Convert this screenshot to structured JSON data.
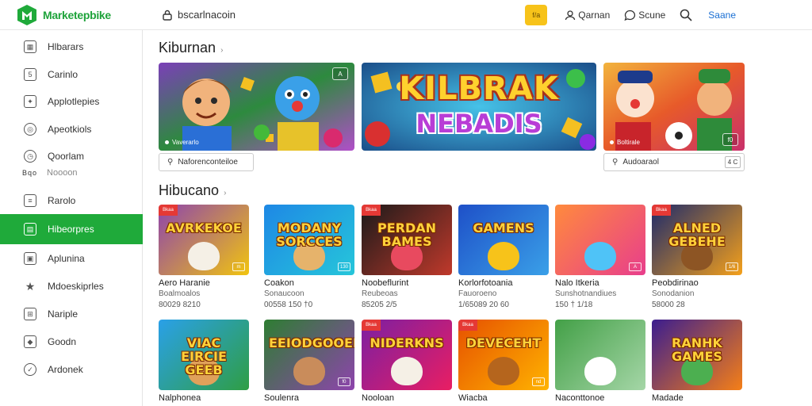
{
  "app": {
    "name": "Marketepbike",
    "search_text": "bscarlnacoin",
    "yellow_button": "f/a",
    "top_link_1": "Qarnan",
    "top_link_2": "Scune",
    "save_label": "Saane",
    "colors": {
      "brand": "#1faa3a",
      "accent_yellow": "#f7c31a",
      "link_blue": "#1a6fd3"
    }
  },
  "sidebar": {
    "items": [
      {
        "label": "Hlbarars",
        "icon": "store-icon"
      },
      {
        "label": "Carinlo",
        "icon": "calendar-icon"
      },
      {
        "label": "Applotlepies",
        "icon": "puzzle-icon"
      },
      {
        "label": "Apeotkiols",
        "icon": "circle-icon"
      },
      {
        "label": "Qoorlam",
        "icon": "clock-icon"
      },
      {
        "label": "Rarolo",
        "icon": "document-icon"
      },
      {
        "label": "Hibeorpres",
        "icon": "folder-icon",
        "active": true
      },
      {
        "label": "Aplunina",
        "icon": "image-icon"
      },
      {
        "label": "Mdoeskiprles",
        "icon": "chart-icon"
      },
      {
        "label": "Nariple",
        "icon": "grid-icon"
      },
      {
        "label": "Goodn",
        "icon": "tag-icon"
      },
      {
        "label": "Ardonek",
        "icon": "check-icon"
      }
    ],
    "sub": {
      "icon_text": "Bqo",
      "label": "Noooon"
    }
  },
  "section1": {
    "title": "Kiburnan",
    "banners": [
      {
        "caption": "Vaverarlo",
        "corner": "A",
        "input": "Naforenconteiloe"
      },
      {
        "headline_1": "KILBRAK",
        "headline_2": "NEBADIS"
      },
      {
        "caption": "Boltirale",
        "corner": "f0",
        "input": "Audoaraol",
        "input_button": "4 C"
      }
    ]
  },
  "section2": {
    "title": "Hibucano",
    "tiles": [
      {
        "art": "AVRKEKOE",
        "name": "Aero Haranie",
        "sub": "Boalmoalos",
        "meta": "80029 8210",
        "corner": "m",
        "badge": "Bkaa"
      },
      {
        "art": "MODANY SORCCES",
        "name": "Coakon",
        "sub": "Sonaucoon",
        "meta": "00558 150 †0",
        "corner": "130",
        "badge": ""
      },
      {
        "art": "PERDAN BAMES",
        "name": "Noobeflurint",
        "sub": "Reubeoas",
        "meta": "85205 2/5",
        "corner": "",
        "badge": "Bkaa"
      },
      {
        "art": "GAMENS",
        "name": "Korlorfotoania",
        "sub": "Fauoroeno",
        "meta": "1/65089 20 60",
        "corner": "",
        "badge": ""
      },
      {
        "art": "",
        "name": "Nalo Itkeria",
        "sub": "Sunshotnandiues",
        "meta": "150 † 1/18",
        "corner": "A",
        "badge": ""
      },
      {
        "art": "ALNED GEBEHE",
        "name": "Peobdirinao",
        "sub": "Sonodanion",
        "meta": "58000 28",
        "corner": "1/6",
        "badge": "Bkaa"
      },
      {
        "art": "VIAC EIRCIE GEEB",
        "name": "Nalphonea",
        "sub": "",
        "meta": "",
        "corner": "",
        "badge": ""
      },
      {
        "art": "EEIODGOOEEF",
        "name": "Soulenra",
        "sub": "",
        "meta": "",
        "corner": "f0",
        "badge": ""
      },
      {
        "art": "NIDERKNS",
        "name": "Nooloan",
        "sub": "",
        "meta": "",
        "corner": "",
        "badge": "Bkaa"
      },
      {
        "art": "DEVECEHT",
        "name": "Wiacba",
        "sub": "",
        "meta": "",
        "corner": "nd",
        "badge": "Bkaa"
      },
      {
        "art": "",
        "name": "Naconttonoe",
        "sub": "",
        "meta": "",
        "corner": "",
        "badge": ""
      },
      {
        "art": "RANHK GAMES",
        "name": "Madade",
        "sub": "",
        "meta": "",
        "corner": "",
        "badge": ""
      }
    ]
  }
}
